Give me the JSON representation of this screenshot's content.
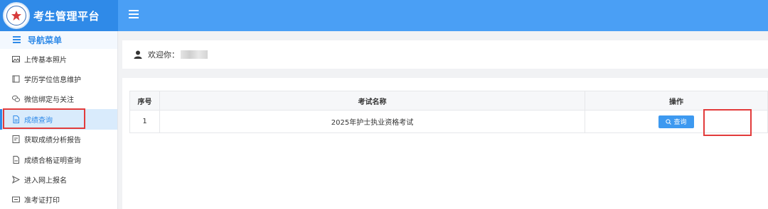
{
  "brand": {
    "title": "考生管理平台"
  },
  "sidebar": {
    "header": "导航菜单",
    "items": [
      {
        "label": "上传基本照片",
        "icon": "image-icon"
      },
      {
        "label": "学历学位信息维护",
        "icon": "book-icon"
      },
      {
        "label": "微信绑定与关注",
        "icon": "wechat-icon"
      },
      {
        "label": "成绩查询",
        "icon": "document-icon",
        "active": true
      },
      {
        "label": "获取成绩分析报告",
        "icon": "report-icon"
      },
      {
        "label": "成绩合格证明查询",
        "icon": "certificate-icon"
      },
      {
        "label": "进入网上报名",
        "icon": "send-icon"
      },
      {
        "label": "准考证打印",
        "icon": "print-icon"
      }
    ]
  },
  "welcome": {
    "text": "欢迎你："
  },
  "table": {
    "headers": [
      "序号",
      "考试名称",
      "操作"
    ],
    "rows": [
      {
        "index": "1",
        "name": "2025年护士执业资格考试",
        "action": "查询"
      }
    ]
  },
  "colors": {
    "accent": "#2f8ae8",
    "topbar": "#4a9ff5",
    "highlight": "#e23b3b"
  }
}
